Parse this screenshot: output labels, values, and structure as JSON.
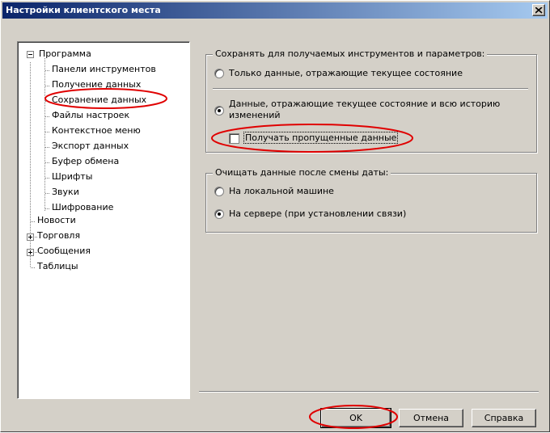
{
  "window": {
    "title": "Настройки клиентского места"
  },
  "tree": {
    "items": [
      {
        "label": "Программа"
      },
      {
        "label": "Панели инструментов"
      },
      {
        "label": "Получение данных"
      },
      {
        "label": "Сохранение данных"
      },
      {
        "label": "Файлы настроек"
      },
      {
        "label": "Контекстное меню"
      },
      {
        "label": "Экспорт данных"
      },
      {
        "label": "Буфер обмена"
      },
      {
        "label": "Шрифты"
      },
      {
        "label": "Звуки"
      },
      {
        "label": "Шифрование"
      },
      {
        "label": "Новости"
      },
      {
        "label": "Торговля"
      },
      {
        "label": "Сообщения"
      },
      {
        "label": "Таблицы"
      }
    ]
  },
  "save_group": {
    "caption": "Сохранять для получаемых инструментов и параметров:",
    "option_current": "Только данные, отражающие текущее состояние",
    "option_history": "Данные, отражающие текущее состояние и всю историю изменений",
    "selected": "history",
    "missed_checkbox_label": "Получать пропущенные данные",
    "missed_checked": false
  },
  "clear_group": {
    "caption": "Очищать данные после смены даты:",
    "option_local": "На локальной машине",
    "option_server": "На сервере (при установлении связи)",
    "selected": "server"
  },
  "buttons": {
    "ok": "OK",
    "cancel": "Отмена",
    "help": "Справка"
  },
  "colors": {
    "titlebar_start": "#0a246a",
    "titlebar_end": "#a6caf0",
    "selection": "#0a246a",
    "annotation": "#e00000",
    "face": "#d4d0c8"
  }
}
